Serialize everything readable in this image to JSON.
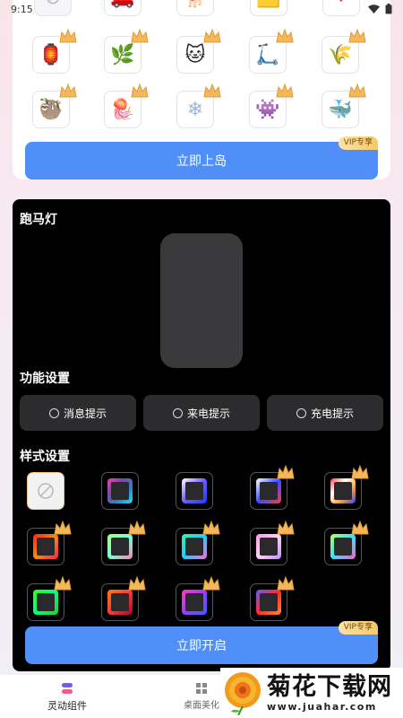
{
  "status_bar": {
    "time": "9:15"
  },
  "top_card": {
    "stickers_row1": [
      {
        "icon": "none-icon",
        "glyph": "⊘"
      },
      {
        "icon": "car-icon",
        "glyph": "🚗"
      },
      {
        "icon": "dog-icon",
        "glyph": "🐕"
      },
      {
        "icon": "cartoon-icon",
        "glyph": "🟨"
      },
      {
        "icon": "heart-icon",
        "glyph": "❤"
      }
    ],
    "stickers_row2": [
      {
        "icon": "lantern-icon",
        "glyph": "🏮"
      },
      {
        "icon": "grass-icon",
        "glyph": "🌿"
      },
      {
        "icon": "black-cat-icon",
        "glyph": "🐱"
      },
      {
        "icon": "scooter-girl-icon",
        "glyph": "🛴"
      },
      {
        "icon": "willow-icon",
        "glyph": "🌾"
      }
    ],
    "stickers_row3": [
      {
        "icon": "sloth-icon",
        "glyph": "🦥"
      },
      {
        "icon": "jellyfish-icon",
        "glyph": "🪼"
      },
      {
        "icon": "snowflake-icon",
        "glyph": "❄"
      },
      {
        "icon": "ghost-icon",
        "glyph": "👾"
      },
      {
        "icon": "whale-icon",
        "glyph": "🐳"
      }
    ],
    "vip_label": "VIP专享",
    "button_label": "立即上岛"
  },
  "marquee_card": {
    "title": "跑马灯",
    "function_title": "功能设置",
    "function_options": [
      "消息提示",
      "来电提示",
      "充电提示"
    ],
    "style_title": "样式设置",
    "vip_label": "VIP专享",
    "button_label": "立即开启"
  },
  "bottom_nav": {
    "items": [
      {
        "label": "灵动组件",
        "icon": "widget-icon"
      },
      {
        "label": "桌面美化",
        "icon": "grid-icon"
      }
    ]
  },
  "watermark": {
    "name": "菊花下载网",
    "url": "www.juahar.com"
  },
  "colors": {
    "accent_blue": "#4f8ff7",
    "card_black": "#000000",
    "vip_gold": "#f6c96a"
  }
}
